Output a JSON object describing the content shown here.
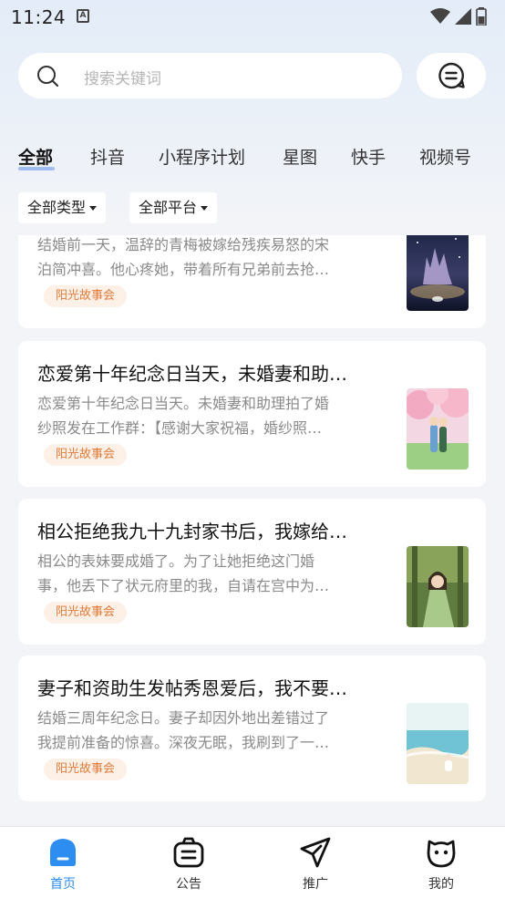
{
  "status_bar": {
    "time": "11:24",
    "a_icon": "A"
  },
  "search": {
    "placeholder": "搜索关键词"
  },
  "tabs": [
    {
      "label": "全部",
      "active": true
    },
    {
      "label": "抖音"
    },
    {
      "label": "小程序计划"
    },
    {
      "label": "星图"
    },
    {
      "label": "快手"
    },
    {
      "label": "视频号"
    }
  ],
  "filters": {
    "type": "全部类型",
    "platform": "全部平台"
  },
  "cards": [
    {
      "title": "",
      "desc_line1": "结婚前一天，温辞的青梅被嫁给残疾易怒的宋",
      "desc_line2": "泊简冲喜。他心疼她，带着所有兄弟前去抢…",
      "tag": "阳光故事会",
      "cover": "castle-night-cover"
    },
    {
      "title": "恋爱第十年纪念日当天，未婚妻和助…",
      "desc_line1": "恋爱第十年纪念日当天。未婚妻和助理拍了婚",
      "desc_line2": "纱照发在工作群：【感谢大家祝福，婚纱照…",
      "tag": "阳光故事会",
      "cover": "cherry-blossom-couple-cover"
    },
    {
      "title": "相公拒绝我九十九封家书后，我嫁给…",
      "desc_line1": "相公的表妹要成婚了。为了让她拒绝这门婚",
      "desc_line2": "事，他丢下了状元府里的我，自请在宫中为…",
      "tag": "阳光故事会",
      "cover": "green-hanfu-girl-cover"
    },
    {
      "title": "妻子和资助生发帖秀恩爱后，我不要…",
      "desc_line1": "结婚三周年纪念日。妻子却因外地出差错过了",
      "desc_line2": "我提前准备的惊喜。深夜无眠，我刷到了一…",
      "tag": "阳光故事会",
      "cover": "seaside-painting-cover"
    }
  ],
  "bottom_nav": [
    {
      "label": "首页",
      "icon": "home-icon",
      "active": true,
      "color": "#2d8df0"
    },
    {
      "label": "公告",
      "icon": "announcement-icon"
    },
    {
      "label": "推广",
      "icon": "paper-plane-icon"
    },
    {
      "label": "我的",
      "icon": "profile-face-icon"
    }
  ]
}
